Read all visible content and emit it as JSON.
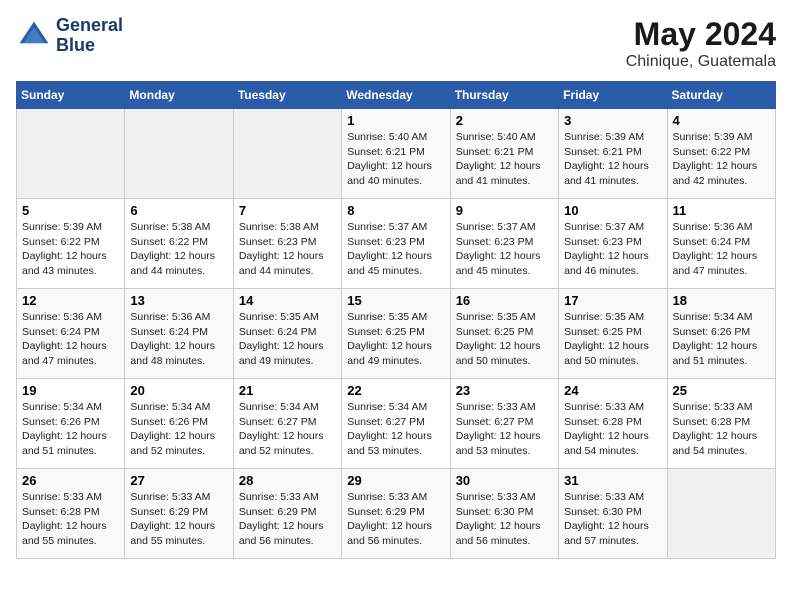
{
  "header": {
    "logo_line1": "General",
    "logo_line2": "Blue",
    "title": "May 2024",
    "subtitle": "Chinique, Guatemala"
  },
  "weekdays": [
    "Sunday",
    "Monday",
    "Tuesday",
    "Wednesday",
    "Thursday",
    "Friday",
    "Saturday"
  ],
  "weeks": [
    [
      {
        "day": "",
        "sunrise": "",
        "sunset": "",
        "daylight": ""
      },
      {
        "day": "",
        "sunrise": "",
        "sunset": "",
        "daylight": ""
      },
      {
        "day": "",
        "sunrise": "",
        "sunset": "",
        "daylight": ""
      },
      {
        "day": "1",
        "sunrise": "Sunrise: 5:40 AM",
        "sunset": "Sunset: 6:21 PM",
        "daylight": "Daylight: 12 hours and 40 minutes."
      },
      {
        "day": "2",
        "sunrise": "Sunrise: 5:40 AM",
        "sunset": "Sunset: 6:21 PM",
        "daylight": "Daylight: 12 hours and 41 minutes."
      },
      {
        "day": "3",
        "sunrise": "Sunrise: 5:39 AM",
        "sunset": "Sunset: 6:21 PM",
        "daylight": "Daylight: 12 hours and 41 minutes."
      },
      {
        "day": "4",
        "sunrise": "Sunrise: 5:39 AM",
        "sunset": "Sunset: 6:22 PM",
        "daylight": "Daylight: 12 hours and 42 minutes."
      }
    ],
    [
      {
        "day": "5",
        "sunrise": "Sunrise: 5:39 AM",
        "sunset": "Sunset: 6:22 PM",
        "daylight": "Daylight: 12 hours and 43 minutes."
      },
      {
        "day": "6",
        "sunrise": "Sunrise: 5:38 AM",
        "sunset": "Sunset: 6:22 PM",
        "daylight": "Daylight: 12 hours and 44 minutes."
      },
      {
        "day": "7",
        "sunrise": "Sunrise: 5:38 AM",
        "sunset": "Sunset: 6:23 PM",
        "daylight": "Daylight: 12 hours and 44 minutes."
      },
      {
        "day": "8",
        "sunrise": "Sunrise: 5:37 AM",
        "sunset": "Sunset: 6:23 PM",
        "daylight": "Daylight: 12 hours and 45 minutes."
      },
      {
        "day": "9",
        "sunrise": "Sunrise: 5:37 AM",
        "sunset": "Sunset: 6:23 PM",
        "daylight": "Daylight: 12 hours and 45 minutes."
      },
      {
        "day": "10",
        "sunrise": "Sunrise: 5:37 AM",
        "sunset": "Sunset: 6:23 PM",
        "daylight": "Daylight: 12 hours and 46 minutes."
      },
      {
        "day": "11",
        "sunrise": "Sunrise: 5:36 AM",
        "sunset": "Sunset: 6:24 PM",
        "daylight": "Daylight: 12 hours and 47 minutes."
      }
    ],
    [
      {
        "day": "12",
        "sunrise": "Sunrise: 5:36 AM",
        "sunset": "Sunset: 6:24 PM",
        "daylight": "Daylight: 12 hours and 47 minutes."
      },
      {
        "day": "13",
        "sunrise": "Sunrise: 5:36 AM",
        "sunset": "Sunset: 6:24 PM",
        "daylight": "Daylight: 12 hours and 48 minutes."
      },
      {
        "day": "14",
        "sunrise": "Sunrise: 5:35 AM",
        "sunset": "Sunset: 6:24 PM",
        "daylight": "Daylight: 12 hours and 49 minutes."
      },
      {
        "day": "15",
        "sunrise": "Sunrise: 5:35 AM",
        "sunset": "Sunset: 6:25 PM",
        "daylight": "Daylight: 12 hours and 49 minutes."
      },
      {
        "day": "16",
        "sunrise": "Sunrise: 5:35 AM",
        "sunset": "Sunset: 6:25 PM",
        "daylight": "Daylight: 12 hours and 50 minutes."
      },
      {
        "day": "17",
        "sunrise": "Sunrise: 5:35 AM",
        "sunset": "Sunset: 6:25 PM",
        "daylight": "Daylight: 12 hours and 50 minutes."
      },
      {
        "day": "18",
        "sunrise": "Sunrise: 5:34 AM",
        "sunset": "Sunset: 6:26 PM",
        "daylight": "Daylight: 12 hours and 51 minutes."
      }
    ],
    [
      {
        "day": "19",
        "sunrise": "Sunrise: 5:34 AM",
        "sunset": "Sunset: 6:26 PM",
        "daylight": "Daylight: 12 hours and 51 minutes."
      },
      {
        "day": "20",
        "sunrise": "Sunrise: 5:34 AM",
        "sunset": "Sunset: 6:26 PM",
        "daylight": "Daylight: 12 hours and 52 minutes."
      },
      {
        "day": "21",
        "sunrise": "Sunrise: 5:34 AM",
        "sunset": "Sunset: 6:27 PM",
        "daylight": "Daylight: 12 hours and 52 minutes."
      },
      {
        "day": "22",
        "sunrise": "Sunrise: 5:34 AM",
        "sunset": "Sunset: 6:27 PM",
        "daylight": "Daylight: 12 hours and 53 minutes."
      },
      {
        "day": "23",
        "sunrise": "Sunrise: 5:33 AM",
        "sunset": "Sunset: 6:27 PM",
        "daylight": "Daylight: 12 hours and 53 minutes."
      },
      {
        "day": "24",
        "sunrise": "Sunrise: 5:33 AM",
        "sunset": "Sunset: 6:28 PM",
        "daylight": "Daylight: 12 hours and 54 minutes."
      },
      {
        "day": "25",
        "sunrise": "Sunrise: 5:33 AM",
        "sunset": "Sunset: 6:28 PM",
        "daylight": "Daylight: 12 hours and 54 minutes."
      }
    ],
    [
      {
        "day": "26",
        "sunrise": "Sunrise: 5:33 AM",
        "sunset": "Sunset: 6:28 PM",
        "daylight": "Daylight: 12 hours and 55 minutes."
      },
      {
        "day": "27",
        "sunrise": "Sunrise: 5:33 AM",
        "sunset": "Sunset: 6:29 PM",
        "daylight": "Daylight: 12 hours and 55 minutes."
      },
      {
        "day": "28",
        "sunrise": "Sunrise: 5:33 AM",
        "sunset": "Sunset: 6:29 PM",
        "daylight": "Daylight: 12 hours and 56 minutes."
      },
      {
        "day": "29",
        "sunrise": "Sunrise: 5:33 AM",
        "sunset": "Sunset: 6:29 PM",
        "daylight": "Daylight: 12 hours and 56 minutes."
      },
      {
        "day": "30",
        "sunrise": "Sunrise: 5:33 AM",
        "sunset": "Sunset: 6:30 PM",
        "daylight": "Daylight: 12 hours and 56 minutes."
      },
      {
        "day": "31",
        "sunrise": "Sunrise: 5:33 AM",
        "sunset": "Sunset: 6:30 PM",
        "daylight": "Daylight: 12 hours and 57 minutes."
      },
      {
        "day": "",
        "sunrise": "",
        "sunset": "",
        "daylight": ""
      }
    ]
  ]
}
